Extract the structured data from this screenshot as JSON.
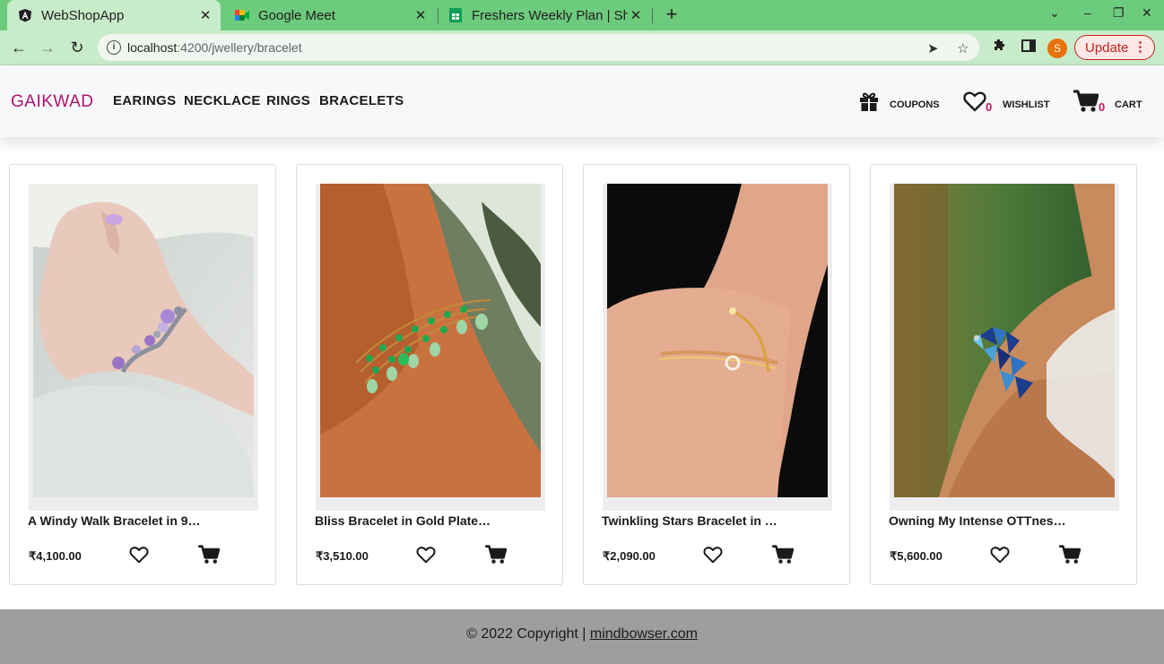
{
  "browser": {
    "tabs": [
      {
        "title": "WebShopApp",
        "active": true
      },
      {
        "title": "Google Meet",
        "active": false
      },
      {
        "title": "Freshers Weekly Plan | Sh",
        "active": false
      }
    ],
    "url_host": "localhost",
    "url_path": ":4200/jwellery/bracelet",
    "update_label": "Update",
    "profile_initial": "S"
  },
  "header": {
    "brand": "GAIKWAD",
    "nav": [
      "EARINGS",
      "NECKLACE",
      "RINGS",
      "BRACELETS"
    ],
    "coupons_label": "COUPONS",
    "wishlist_label": "WISHLIST",
    "wishlist_count": "0",
    "cart_label": "CART",
    "cart_count": "0"
  },
  "products": [
    {
      "name": "A Windy Walk Bracelet in 9…",
      "price": "₹4,100.00"
    },
    {
      "name": "Bliss Bracelet in Gold Plate…",
      "price": "₹3,510.00"
    },
    {
      "name": "Twinkling Stars Bracelet in …",
      "price": "₹2,090.00"
    },
    {
      "name": "Owning My Intense OTTnes…",
      "price": "₹5,600.00"
    }
  ],
  "footer": {
    "copyright": "© 2022 Copyright | ",
    "link": "mindbowser.com"
  },
  "colors": {
    "tabstrip": "#6dcb7d",
    "brand": "#b0126d",
    "count": "#c2185b",
    "footer": "#9e9e9e"
  }
}
